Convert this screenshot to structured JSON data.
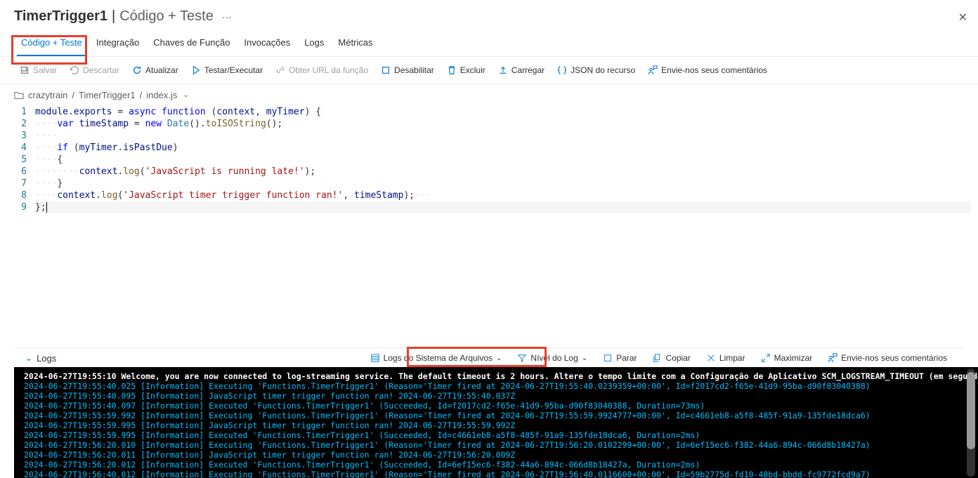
{
  "header": {
    "title": "TimerTrigger1",
    "subtitle": "Código + Teste",
    "more": "···"
  },
  "tabs": [
    {
      "label": "Código + Teste",
      "active": true
    },
    {
      "label": "Integração"
    },
    {
      "label": "Chaves de Função"
    },
    {
      "label": "Invocações"
    },
    {
      "label": "Logs"
    },
    {
      "label": "Métricas"
    }
  ],
  "toolbar": {
    "save": "Salvar",
    "discard": "Descartar",
    "refresh": "Atualizar",
    "test": "Testar/Executar",
    "geturl": "Obter URL da função",
    "disable": "Desabilitar",
    "delete": "Excluir",
    "upload": "Carregar",
    "json": "JSON do recurso",
    "feedback": "Envie-nos seus comentários"
  },
  "breadcrumb": {
    "root": "crazytrain",
    "func": "TimerTrigger1",
    "file": "index.js"
  },
  "code": {
    "lines": [
      "1",
      "2",
      "3",
      "4",
      "5",
      "6",
      "7",
      "8",
      "9"
    ]
  },
  "logsbar": {
    "label": "Logs",
    "source": "Logs do Sistema de Arquivos",
    "level": "Nível do Log",
    "stop": "Parar",
    "copy": "Copiar",
    "clear": "Limpar",
    "maximize": "Maximizar",
    "feedback": "Envie-nos seus comentários"
  },
  "console": {
    "welcome": "2024-06-27T19:55:10  Welcome, you are now connected to log-streaming service. The default timeout is 2 hours. Altere o tempo limite com a Configuração de Aplicativo SCM_LOGSTREAM_TIMEOUT (em segundos).",
    "lines": [
      "2024-06-27T19:55:40.025 [Information] Executing 'Functions.TimerTrigger1' (Reason='Timer fired at 2024-06-27T19:55:40.0239359+00:00', Id=f2017cd2-f65e-41d9-95ba-d90f83040388)",
      "2024-06-27T19:55:40.095 [Information] JavaScript timer trigger function ran! 2024-06-27T19:55:40.037Z",
      "2024-06-27T19:55:40.097 [Information] Executed 'Functions.TimerTrigger1' (Succeeded, Id=f2017cd2-f65e-41d9-95ba-d90f83040388, Duration=73ms)",
      "2024-06-27T19:55:59.992 [Information] Executing 'Functions.TimerTrigger1' (Reason='Timer fired at 2024-06-27T19:55:59.9924777+00:00', Id=c4661eb8-a5f8-485f-91a9-135fde18dca6)",
      "2024-06-27T19:55:59.995 [Information] JavaScript timer trigger function ran! 2024-06-27T19:55:59.992Z",
      "2024-06-27T19:55:59.995 [Information] Executed 'Functions.TimerTrigger1' (Succeeded, Id=c4661eb8-a5f8-485f-91a9-135fde18dca6, Duration=2ms)",
      "2024-06-27T19:56:20.010 [Information] Executing 'Functions.TimerTrigger1' (Reason='Timer fired at 2024-06-27T19:56:20.0102299+00:00', Id=6ef15ec6-f382-44a6-894c-066d8b18427a)",
      "2024-06-27T19:56:20.011 [Information] JavaScript timer trigger function ran! 2024-06-27T19:56:20.009Z",
      "2024-06-27T19:56:20.012 [Information] Executed 'Functions.TimerTrigger1' (Succeeded, Id=6ef15ec6-f382-44a6-894c-066d8b18427a, Duration=2ms)",
      "2024-06-27T19:56:40.012 [Information] Executing 'Functions.TimerTrigger1' (Reason='Timer fired at 2024-06-27T19:56:40.0116600+00:00', Id=59b2775d-fd10-48bd-bbdd-fc9772fcd9a7)"
    ]
  }
}
